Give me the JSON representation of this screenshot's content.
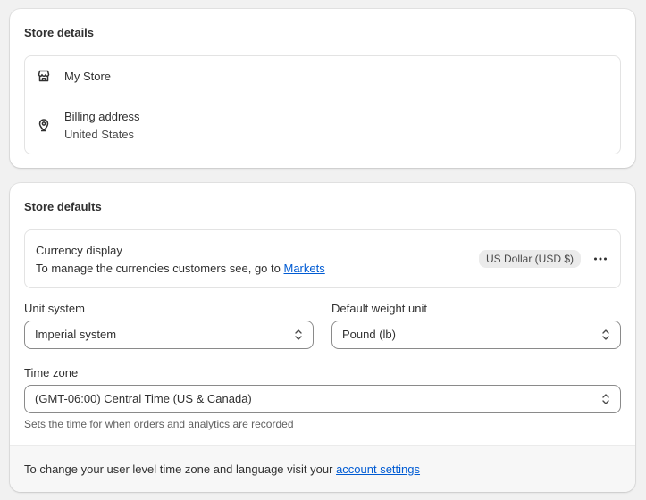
{
  "store_details": {
    "title": "Store details",
    "store_name": "My Store",
    "store_icon": "store-icon",
    "billing_label": "Billing address",
    "billing_value": "United States",
    "billing_icon": "location-pin-icon"
  },
  "store_defaults": {
    "title": "Store defaults",
    "currency": {
      "label": "Currency display",
      "description": "To manage the currencies customers see, go to",
      "link_text": "Markets",
      "badge": "US Dollar (USD $)",
      "more_icon": "ellipsis-icon"
    },
    "unit_system": {
      "label": "Unit system",
      "value": "Imperial system"
    },
    "weight_unit": {
      "label": "Default weight unit",
      "value": "Pound (lb)"
    },
    "time_zone": {
      "label": "Time zone",
      "value": "(GMT-06:00) Central Time (US & Canada)",
      "help": "Sets the time for when orders and analytics are recorded"
    },
    "footer": {
      "text": "To change your user level time zone and language visit your",
      "link_text": "account settings"
    }
  },
  "colors": {
    "link": "#005bd3",
    "background": "#f1f1f1",
    "card": "#ffffff",
    "badge_bg": "#ebebeb"
  }
}
